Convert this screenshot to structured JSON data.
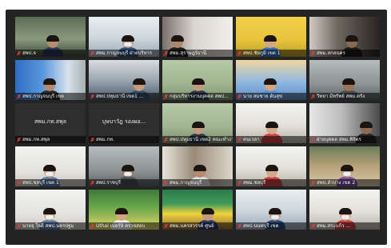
{
  "meeting": {
    "tiles": [
      {
        "caption": "สพป.จ",
        "muted": true,
        "active": true,
        "scene": "desk-green",
        "masked": false
      },
      {
        "caption": "สพม.กาญจนบุรี ฝ่ายบริหาร",
        "muted": true,
        "scene": "office-blue",
        "masked": true
      },
      {
        "caption": "สพม.สุราษฎร์ธานี",
        "muted": true,
        "scene": "wall-white",
        "masked": false
      },
      {
        "caption": "สพป.ชัยภูมิ เขต 1",
        "muted": true,
        "scene": "board-yellow",
        "masked": false
      },
      {
        "caption": "สพม.สกลนคร",
        "muted": true,
        "scene": "dark-room",
        "masked": false
      },
      {
        "caption": "สพป.กาญจนบุรี เขต",
        "muted": true,
        "scene": "curtain-blue",
        "masked": false
      },
      {
        "caption": "สพป.ปทุมธานี เขต1 ...",
        "muted": true,
        "scene": "meeting-room",
        "masked": false
      },
      {
        "caption": "กลุ่มบริหารงานบุคคล สพป...",
        "muted": true,
        "scene": "plain-green",
        "masked": false
      },
      {
        "caption": "นาย สมชาย ต้นสุข",
        "muted": true,
        "scene": "blue-sky",
        "masked": false
      },
      {
        "caption": "วิทยา มีทรัพย์ สพม.ตรัง",
        "muted": true,
        "scene": "office-grey",
        "masked": false
      },
      {
        "caption": "สพม.กท.สพุล",
        "muted": true,
        "scene": "name-only",
        "avatar_name": "สพม.กท.สพุล"
      },
      {
        "caption": "สพม.กท.",
        "muted": true,
        "scene": "name-only",
        "avatar_name": "บุษบาวัฎ รองผอ..."
      },
      {
        "caption": "สพป.ปทุมธานี เขต2 คณะทำงาน",
        "muted": true,
        "scene": "plain-green",
        "masked": false
      },
      {
        "caption": "คนเวลา",
        "muted": true,
        "scene": "bright-office",
        "masked": false
      },
      {
        "caption": "ฝ่ายบุคคล สพม.พิจิตร",
        "muted": true,
        "scene": "dark-window",
        "masked": false
      },
      {
        "caption": "สพป.ชลบุรี เขต 1",
        "muted": true,
        "scene": "white-wall",
        "masked": true
      },
      {
        "caption": "สพป.ราชบุรี",
        "muted": true,
        "scene": "office-grey",
        "masked": true
      },
      {
        "caption": "สพม.กาญจนบุรี",
        "muted": true,
        "scene": "window-bright",
        "masked": false
      },
      {
        "caption": "สพม.ชลบุรี",
        "muted": true,
        "scene": "bright-office",
        "masked": false
      },
      {
        "caption": "สพป.ลำปาง เขต 2",
        "muted": true,
        "scene": "shelf",
        "masked": true
      },
      {
        "caption": "นายจุ ใจดี สพป.นครปฐม",
        "muted": true,
        "scene": "white-wall",
        "masked": true
      },
      {
        "caption": "Uthai เบอร์9 ตรวจสอบ",
        "muted": true,
        "scene": "banner-green",
        "masked": false
      },
      {
        "caption": "สพม.นครสวรรค์ ศูนย์",
        "muted": true,
        "scene": "banner-yellow",
        "masked": false
      },
      {
        "caption": "สพป.นนทบุรี เขต",
        "muted": true,
        "scene": "office-blue",
        "masked": true
      },
      {
        "caption": "สพม.สระแก้ว ...",
        "muted": true,
        "scene": "bright-office",
        "masked": true
      }
    ]
  },
  "colors": {
    "window_bg": "#242424",
    "active_outline": "#e3c233",
    "mic_muted": "#e03b3b"
  }
}
